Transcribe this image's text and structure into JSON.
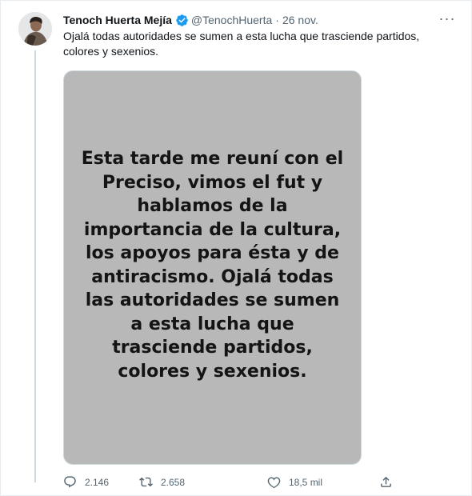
{
  "tweet": {
    "author_name": "Tenoch Huerta Mejía",
    "handle": "@TenochHuerta",
    "separator": "·",
    "date": "26 nov.",
    "more_label": "···",
    "text": "Ojalá todas autoridades se sumen a esta lucha que trasciende partidos, colores y sexenios.",
    "verified": true,
    "verified_color": "#1d9bf0"
  },
  "media": {
    "image_text": "Esta tarde me reuní con el Preciso, vimos el fut y hablamos de la importancia de la cultura, los apoyos para ésta y de antiracismo. Ojalá todas las autoridades se sumen a esta lucha que trasciende partidos, colores y sexenios.",
    "background_color": "#b8b8b8"
  },
  "actions": {
    "reply": {
      "icon": "reply-icon",
      "count": "2.146"
    },
    "retweet": {
      "icon": "retweet-icon",
      "count": "2.658"
    },
    "like": {
      "icon": "heart-icon",
      "count": "18,5 mil"
    },
    "share": {
      "icon": "share-icon"
    }
  }
}
